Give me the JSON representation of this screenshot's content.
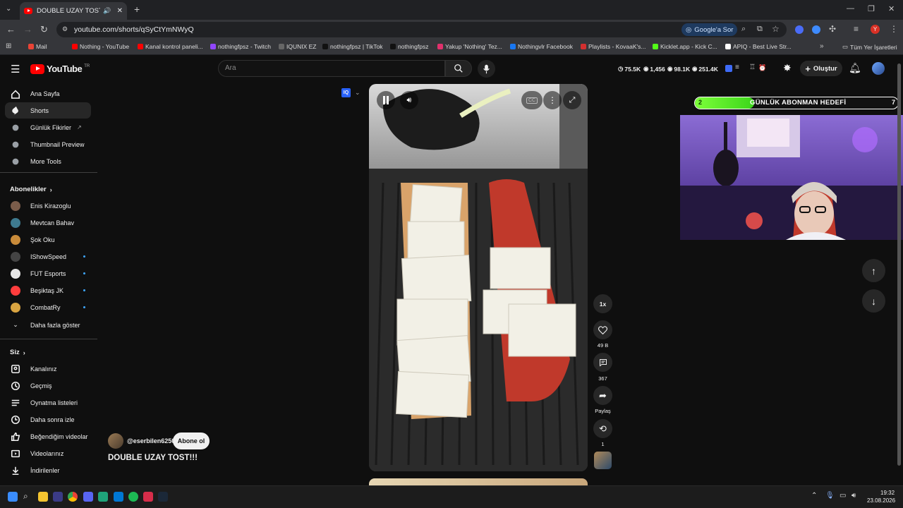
{
  "browser": {
    "tab_title": "DOUBLE UZAY TOST!!! - Yo",
    "url": "youtube.com/shorts/qSyCtYmNWyQ",
    "google_sor_label": "Google'a Sor",
    "bookmarks": [
      {
        "label": "Mail",
        "color": "#ea4335"
      },
      {
        "label": "Nothing - YouTube",
        "color": "#ff0000"
      },
      {
        "label": "Kanal kontrol paneli...",
        "color": "#ff0000"
      },
      {
        "label": "nothingfpsz - Twitch",
        "color": "#9146ff"
      },
      {
        "label": "IQUNIX EZ",
        "color": "#666666"
      },
      {
        "label": "nothingfpsz | TikTok",
        "color": "#111111"
      },
      {
        "label": "nothingfpsz",
        "color": "#111111"
      },
      {
        "label": "Yakup 'Nothing' Tez...",
        "color": "#e1306c"
      },
      {
        "label": "Nothingvlr Facebook",
        "color": "#1877f2"
      },
      {
        "label": "Playlists - KovaaK's...",
        "color": "#d32f2f"
      },
      {
        "label": "Kicklet.app - Kick C...",
        "color": "#53fc18"
      },
      {
        "label": "APIQ - Best Live Str...",
        "color": "#ffffff"
      }
    ],
    "all_bookmarks_label": "Tüm Yer İşaretleri"
  },
  "masthead": {
    "logo_text": "YouTube",
    "logo_region": "TR",
    "search_placeholder": "Ara",
    "stats": [
      "75.5K",
      "1,456",
      "98.1K",
      "251.4K"
    ],
    "create_label": "Oluştur",
    "accent_color": "#ff0000"
  },
  "sidebar": {
    "main_items": [
      {
        "label": "Ana Sayfa",
        "icon": "home-icon"
      },
      {
        "label": "Shorts",
        "icon": "shorts-icon",
        "active": true
      },
      {
        "label": "Günlük Fikirler",
        "icon": "ideas-icon"
      },
      {
        "label": "Thumbnail Preview",
        "icon": "thumbnail-icon"
      },
      {
        "label": "More Tools",
        "icon": "tools-icon"
      }
    ],
    "subscriptions_title": "Abonelikler",
    "subscriptions": [
      {
        "label": "Enis Kirazoglu",
        "live": false
      },
      {
        "label": "Mevtcan Bahav",
        "live": false
      },
      {
        "label": "Şok Oku",
        "live": false
      },
      {
        "label": "IShowSpeed",
        "live": true
      },
      {
        "label": "FUT Esports",
        "live": true
      },
      {
        "label": "Beşiktaş JK",
        "live": true
      },
      {
        "label": "CombatRy",
        "live": true
      }
    ],
    "show_more_label": "Daha fazla göster",
    "you_title": "Siz",
    "you_items": [
      {
        "label": "Kanalınız",
        "icon": "channel-icon"
      },
      {
        "label": "Geçmiş",
        "icon": "history-icon"
      },
      {
        "label": "Oynatma listeleri",
        "icon": "playlists-icon"
      },
      {
        "label": "Daha sonra izle",
        "icon": "watch-later-icon"
      },
      {
        "label": "Beğendiğim videolar",
        "icon": "like-icon"
      },
      {
        "label": "Videolarınız",
        "icon": "your-videos-icon"
      },
      {
        "label": "İndirilenler",
        "icon": "download-icon"
      }
    ]
  },
  "short": {
    "channel": "@eserbilen6250",
    "subscribe_label": "Abone ol",
    "title": "DOUBLE UZAY TOST!!!",
    "speed_label": "1x",
    "likes": "49 B",
    "comments": "367",
    "share_label": "Paylaş",
    "remix_count": "1"
  },
  "overlay": {
    "goal_title": "GÜNLÜK ABONMAN HEDEFİ",
    "goal_current": "2",
    "goal_target": "7",
    "goal_fraction": 0.29
  },
  "taskbar": {
    "time": "19:32",
    "date": "23.08.2026"
  }
}
